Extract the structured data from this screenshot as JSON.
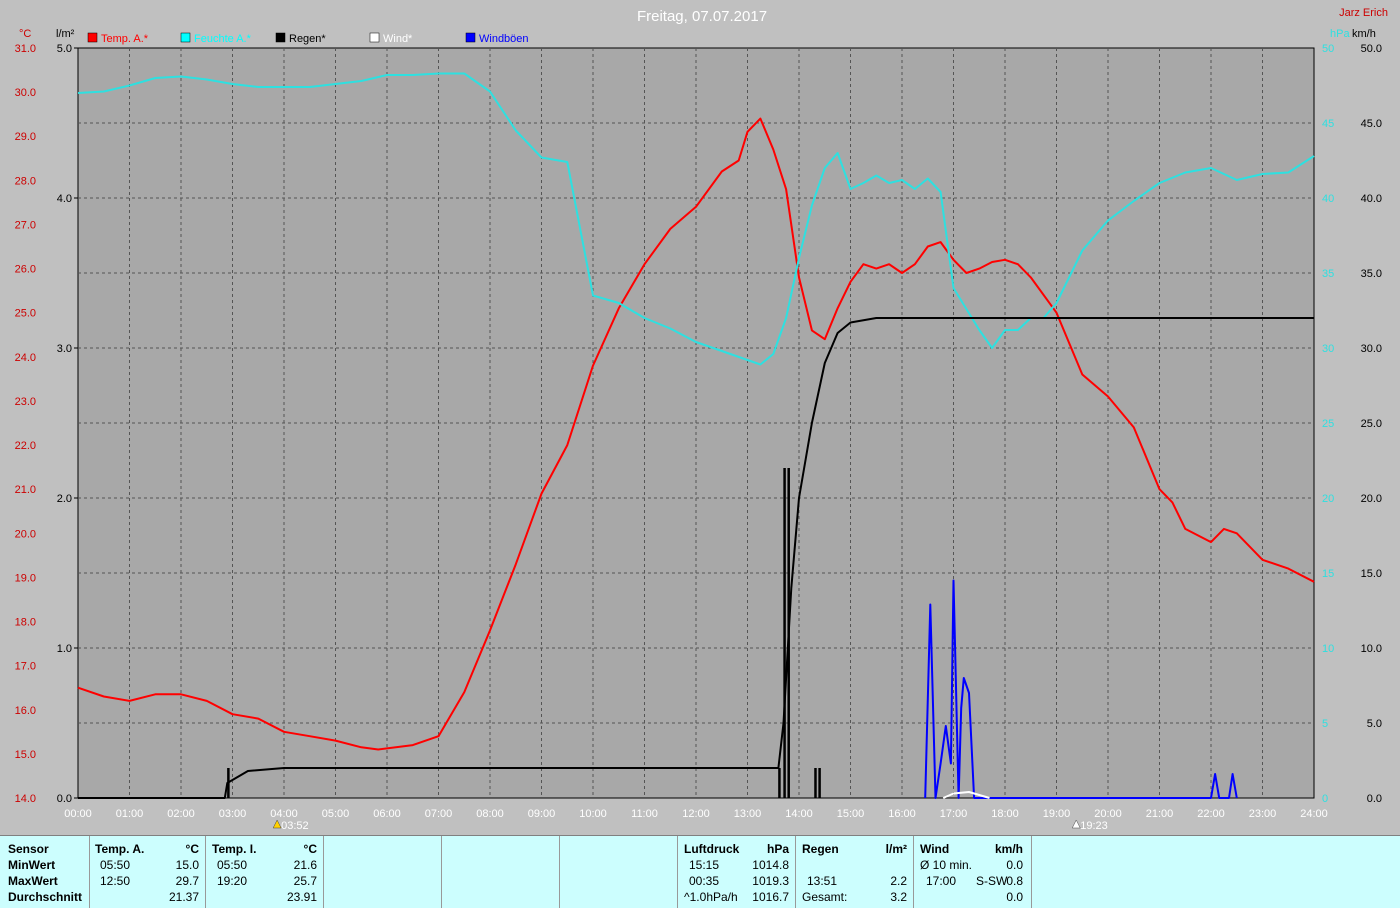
{
  "author": "Jarz Erich",
  "chart_data": {
    "type": "line",
    "title": "Freitag, 07.07.2017",
    "units": {
      "left_temp": "°C",
      "left_rain": "l/m²",
      "right_pressure": "hPa",
      "right_wind": "km/h"
    },
    "x_ticks": [
      "00:00",
      "01:00",
      "02:00",
      "03:00",
      "04:00",
      "05:00",
      "06:00",
      "07:00",
      "08:00",
      "09:00",
      "10:00",
      "11:00",
      "12:00",
      "13:00",
      "14:00",
      "15:00",
      "16:00",
      "17:00",
      "18:00",
      "19:00",
      "20:00",
      "21:00",
      "22:00",
      "23:00",
      "24:00"
    ],
    "temp_ticks": [
      "14.0",
      "15.0",
      "16.0",
      "17.0",
      "18.0",
      "19.0",
      "20.0",
      "21.0",
      "22.0",
      "23.0",
      "24.0",
      "25.0",
      "26.0",
      "27.0",
      "28.0",
      "29.0",
      "30.0",
      "31.0"
    ],
    "rain_ticks": [
      "0.0",
      "1.0",
      "2.0",
      "3.0",
      "4.0",
      "5.0"
    ],
    "pressure_ticks": [
      "0",
      "5",
      "10",
      "15",
      "20",
      "25",
      "30",
      "35",
      "40",
      "45",
      "50"
    ],
    "wind_ticks": [
      "0.0",
      "5.0",
      "10.0",
      "15.0",
      "20.0",
      "25.0",
      "30.0",
      "35.0",
      "40.0",
      "45.0",
      "50.0"
    ],
    "ylim_temp": [
      14,
      31
    ],
    "ylim_rain": [
      0,
      5
    ],
    "ylim_wind": [
      0,
      50
    ],
    "sunrise": "03:52",
    "sunset": "19:23",
    "legend": [
      {
        "name": "Temp. A.*",
        "color": "#ff0000"
      },
      {
        "name": "Feuchte A.*",
        "color": "#00ffff"
      },
      {
        "name": "Regen*",
        "color": "#000000"
      },
      {
        "name": "Wind*",
        "color": "#ffffff"
      },
      {
        "name": "Windböen",
        "color": "#0000ff"
      }
    ],
    "series": [
      {
        "name": "Temp. A.*",
        "axis": "temp",
        "color": "#ff0000",
        "points": [
          [
            0,
            16.5
          ],
          [
            0.5,
            16.3
          ],
          [
            1,
            16.2
          ],
          [
            1.5,
            16.35
          ],
          [
            2,
            16.35
          ],
          [
            2.5,
            16.2
          ],
          [
            3,
            15.9
          ],
          [
            3.5,
            15.8
          ],
          [
            4,
            15.5
          ],
          [
            4.5,
            15.4
          ],
          [
            5,
            15.3
          ],
          [
            5.5,
            15.15
          ],
          [
            5.83,
            15.1
          ],
          [
            6.5,
            15.2
          ],
          [
            7,
            15.4
          ],
          [
            7.5,
            16.4
          ],
          [
            8,
            17.8
          ],
          [
            8.5,
            19.3
          ],
          [
            9,
            20.9
          ],
          [
            9.5,
            22.0
          ],
          [
            10,
            23.8
          ],
          [
            10.5,
            25.1
          ],
          [
            11,
            26.1
          ],
          [
            11.5,
            26.9
          ],
          [
            12,
            27.4
          ],
          [
            12.5,
            28.2
          ],
          [
            12.83,
            28.45
          ],
          [
            13,
            29.1
          ],
          [
            13.25,
            29.4
          ],
          [
            13.5,
            28.7
          ],
          [
            13.75,
            27.8
          ],
          [
            14,
            25.8
          ],
          [
            14.25,
            24.6
          ],
          [
            14.5,
            24.4
          ],
          [
            14.75,
            25.1
          ],
          [
            15,
            25.7
          ],
          [
            15.25,
            26.1
          ],
          [
            15.5,
            26.0
          ],
          [
            15.75,
            26.1
          ],
          [
            16,
            25.9
          ],
          [
            16.25,
            26.1
          ],
          [
            16.5,
            26.5
          ],
          [
            16.75,
            26.6
          ],
          [
            17,
            26.2
          ],
          [
            17.25,
            25.9
          ],
          [
            17.5,
            26.0
          ],
          [
            17.75,
            26.15
          ],
          [
            18,
            26.2
          ],
          [
            18.25,
            26.1
          ],
          [
            18.5,
            25.8
          ],
          [
            19,
            25.0
          ],
          [
            19.5,
            23.6
          ],
          [
            20,
            23.1
          ],
          [
            20.5,
            22.4
          ],
          [
            21,
            21.0
          ],
          [
            21.25,
            20.7
          ],
          [
            21.5,
            20.1
          ],
          [
            22,
            19.8
          ],
          [
            22.25,
            20.1
          ],
          [
            22.5,
            20.0
          ],
          [
            23,
            19.4
          ],
          [
            23.5,
            19.2
          ],
          [
            24,
            18.9
          ]
        ]
      },
      {
        "name": "Feuchte A.*",
        "axis": "wind",
        "color": "#2ee0e0",
        "points": [
          [
            0,
            47.0
          ],
          [
            0.5,
            47.1
          ],
          [
            1,
            47.5
          ],
          [
            1.5,
            48.0
          ],
          [
            2,
            48.1
          ],
          [
            2.5,
            47.9
          ],
          [
            3,
            47.6
          ],
          [
            3.5,
            47.4
          ],
          [
            4,
            47.4
          ],
          [
            4.5,
            47.4
          ],
          [
            5,
            47.6
          ],
          [
            5.5,
            47.8
          ],
          [
            6,
            48.2
          ],
          [
            6.5,
            48.2
          ],
          [
            7,
            48.3
          ],
          [
            7.5,
            48.3
          ],
          [
            8,
            47.1
          ],
          [
            8.5,
            44.5
          ],
          [
            9,
            42.7
          ],
          [
            9.5,
            42.4
          ],
          [
            10,
            33.5
          ],
          [
            10.5,
            33.0
          ],
          [
            11,
            32.0
          ],
          [
            11.5,
            31.3
          ],
          [
            12,
            30.4
          ],
          [
            12.5,
            29.8
          ],
          [
            13,
            29.2
          ],
          [
            13.25,
            28.9
          ],
          [
            13.5,
            29.6
          ],
          [
            13.75,
            32.0
          ],
          [
            14,
            36.0
          ],
          [
            14.25,
            39.5
          ],
          [
            14.5,
            42.0
          ],
          [
            14.75,
            43.0
          ],
          [
            15,
            40.6
          ],
          [
            15.25,
            41.0
          ],
          [
            15.5,
            41.5
          ],
          [
            15.75,
            41.0
          ],
          [
            16,
            41.2
          ],
          [
            16.25,
            40.6
          ],
          [
            16.5,
            41.3
          ],
          [
            16.75,
            40.4
          ],
          [
            17,
            34.0
          ],
          [
            17.25,
            32.6
          ],
          [
            17.5,
            31.2
          ],
          [
            17.75,
            30.0
          ],
          [
            18,
            31.2
          ],
          [
            18.25,
            31.2
          ],
          [
            18.5,
            32.0
          ],
          [
            18.75,
            32.0
          ],
          [
            19,
            33.0
          ],
          [
            19.5,
            36.5
          ],
          [
            20,
            38.5
          ],
          [
            20.5,
            39.8
          ],
          [
            21,
            41.0
          ],
          [
            21.5,
            41.7
          ],
          [
            22,
            42.0
          ],
          [
            22.5,
            41.2
          ],
          [
            23,
            41.6
          ],
          [
            23.5,
            41.7
          ],
          [
            24,
            42.8
          ]
        ]
      },
      {
        "name": "Regen*",
        "axis": "rain",
        "color": "#000000",
        "points": [
          [
            0,
            0
          ],
          [
            2.85,
            0
          ],
          [
            2.9,
            0.1
          ],
          [
            3.3,
            0.18
          ],
          [
            4,
            0.2
          ],
          [
            5,
            0.2
          ],
          [
            6,
            0.2
          ],
          [
            7,
            0.2
          ],
          [
            8,
            0.2
          ],
          [
            9,
            0.2
          ],
          [
            10,
            0.2
          ],
          [
            11,
            0.2
          ],
          [
            12,
            0.2
          ],
          [
            13,
            0.2
          ],
          [
            13.6,
            0.2
          ],
          [
            13.7,
            0.5
          ],
          [
            13.85,
            1.4
          ],
          [
            14,
            2.0
          ],
          [
            14.25,
            2.5
          ],
          [
            14.5,
            2.9
          ],
          [
            14.75,
            3.1
          ],
          [
            15,
            3.17
          ],
          [
            15.5,
            3.2
          ],
          [
            16,
            3.2
          ],
          [
            17,
            3.2
          ],
          [
            18,
            3.2
          ],
          [
            19,
            3.2
          ],
          [
            20,
            3.2
          ],
          [
            21,
            3.2
          ],
          [
            22,
            3.2
          ],
          [
            23,
            3.2
          ],
          [
            24,
            3.2
          ]
        ]
      },
      {
        "name": "Windböen",
        "axis": "wind",
        "color": "#0000ff",
        "points": [
          [
            16.45,
            0
          ],
          [
            16.55,
            12.9
          ],
          [
            16.65,
            0
          ],
          [
            16.75,
            2.3
          ],
          [
            16.85,
            4.8
          ],
          [
            16.95,
            2.3
          ],
          [
            17.0,
            14.5
          ],
          [
            17.1,
            0
          ],
          [
            17.15,
            6.0
          ],
          [
            17.2,
            8.0
          ],
          [
            17.3,
            7.0
          ],
          [
            17.4,
            0
          ],
          [
            17.5,
            0
          ],
          [
            22.0,
            0
          ],
          [
            22.08,
            1.6
          ],
          [
            22.16,
            0
          ],
          [
            22.35,
            0
          ],
          [
            22.42,
            1.6
          ],
          [
            22.5,
            0
          ]
        ]
      },
      {
        "name": "Wind*",
        "axis": "wind",
        "color": "#ffffff",
        "points": [
          [
            16.8,
            0
          ],
          [
            17.0,
            0.3
          ],
          [
            17.3,
            0.4
          ],
          [
            17.5,
            0.2
          ],
          [
            17.7,
            0
          ]
        ]
      }
    ],
    "rain_spikes": [
      [
        2.92,
        0.2
      ],
      [
        13.62,
        0.2
      ],
      [
        13.72,
        2.2
      ],
      [
        13.8,
        2.2
      ],
      [
        14.32,
        0.2
      ],
      [
        14.4,
        0.2
      ]
    ]
  },
  "stats": {
    "sensor": {
      "header": "Sensor",
      "rows": [
        "MinWert",
        "MaxWert",
        "Durchschnitt"
      ]
    },
    "temp_a": {
      "header": "Temp. A.",
      "unit": "°C",
      "rows": [
        [
          "05:50",
          "15.0"
        ],
        [
          "12:50",
          "29.7"
        ],
        [
          "",
          "21.37"
        ]
      ]
    },
    "temp_i": {
      "header": "Temp. I.",
      "unit": "°C",
      "rows": [
        [
          "05:50",
          "21.6"
        ],
        [
          "19:20",
          "25.7"
        ],
        [
          "",
          "23.91"
        ]
      ]
    },
    "pressure": {
      "header": "Luftdruck",
      "unit": "hPa",
      "rows": [
        [
          "15:15",
          "1014.8"
        ],
        [
          "00:35",
          "1019.3"
        ],
        [
          "^1.0hPa/h",
          "1016.7"
        ]
      ]
    },
    "rain": {
      "header": "Regen",
      "unit": "l/m²",
      "rows": [
        [
          "",
          ""
        ],
        [
          "13:51",
          "2.2"
        ],
        [
          "Gesamt:",
          "3.2"
        ]
      ]
    },
    "wind": {
      "header": "Wind",
      "unit": "km/h",
      "rows": [
        [
          "Ø 10 min.",
          "",
          "0.0"
        ],
        [
          "17:00",
          "S-SW",
          "0.8"
        ],
        [
          "",
          "",
          "0.0"
        ]
      ]
    }
  }
}
